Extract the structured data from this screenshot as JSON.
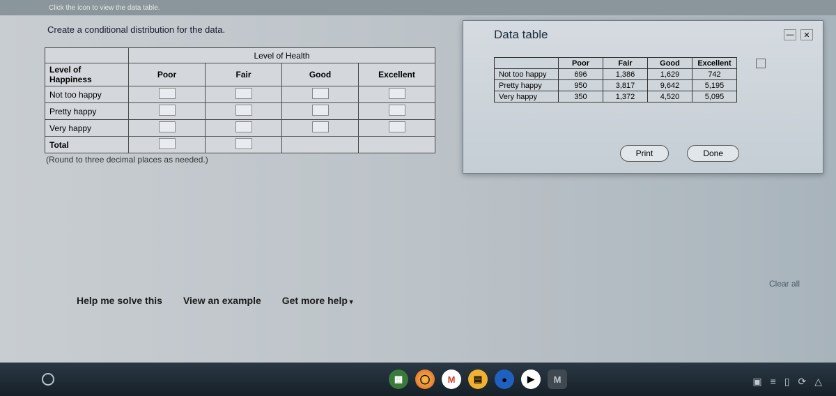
{
  "topbar_hint": "Click the icon to view the data table.",
  "instruction": "Create a conditional distribution for the data.",
  "cond_table": {
    "super_header": "Level of Health",
    "corner_label": "Level of Happiness",
    "columns": [
      "Poor",
      "Fair",
      "Good",
      "Excellent"
    ],
    "rows": [
      "Not too happy",
      "Pretty happy",
      "Very happy",
      "Total"
    ]
  },
  "rounding_note": "(Round to three decimal places as needed.)",
  "help": {
    "solve": "Help me solve this",
    "example": "View an example",
    "more": "Get more help"
  },
  "dialog": {
    "title": "Data table",
    "columns": [
      "Poor",
      "Fair",
      "Good",
      "Excellent"
    ],
    "rows": [
      {
        "label": "Not too happy",
        "values": [
          "696",
          "1,386",
          "1,629",
          "742"
        ]
      },
      {
        "label": "Pretty happy",
        "values": [
          "950",
          "3,817",
          "9,642",
          "5,195"
        ]
      },
      {
        "label": "Very happy",
        "values": [
          "350",
          "1,372",
          "4,520",
          "5,095"
        ]
      }
    ],
    "print": "Print",
    "done": "Done"
  },
  "clear_all": "Clear all",
  "chart_data": {
    "type": "table",
    "title": "Data table",
    "columns": [
      "Poor",
      "Fair",
      "Good",
      "Excellent"
    ],
    "rows": [
      "Not too happy",
      "Pretty happy",
      "Very happy"
    ],
    "values": [
      [
        696,
        1386,
        1629,
        742
      ],
      [
        950,
        3817,
        9642,
        5195
      ],
      [
        350,
        1372,
        4520,
        5095
      ]
    ]
  }
}
